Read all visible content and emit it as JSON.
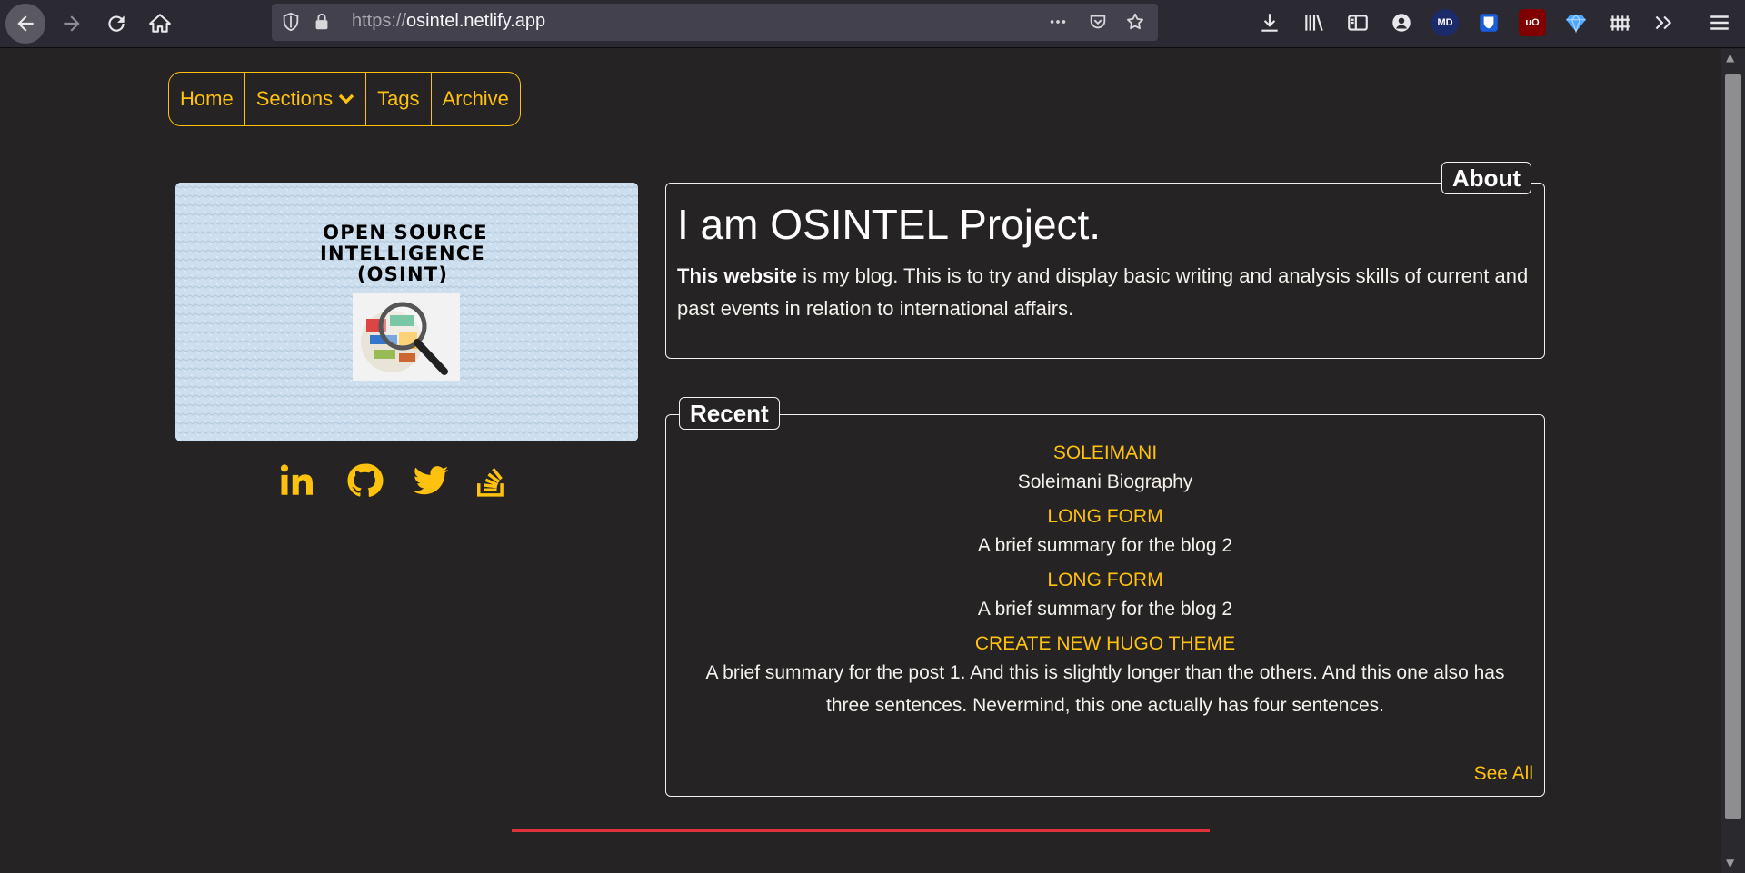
{
  "browser": {
    "url_protocol": "https://",
    "url_host": "osintel.netlify.app",
    "extension_badges": [
      "MD",
      "uO"
    ]
  },
  "nav": {
    "items": [
      {
        "label": "Home"
      },
      {
        "label": "Sections"
      },
      {
        "label": "Tags"
      },
      {
        "label": "Archive"
      }
    ]
  },
  "hero": {
    "line1": "OPEN SOURCE",
    "line2": "INTELLIGENCE",
    "line3": "(OSINT)"
  },
  "social": [
    "linkedin-icon",
    "github-icon",
    "twitter-icon",
    "stackoverflow-icon"
  ],
  "about": {
    "legend": "About",
    "heading": "I am OSINTEL Project.",
    "text_bold": "This website",
    "text_rest": " is my blog. This is to try and display basic writing and analysis skills of current and past events in relation to international affairs."
  },
  "recent": {
    "legend": "Recent",
    "posts": [
      {
        "title": "SOLEIMANI",
        "summary": "Soleimani Biography"
      },
      {
        "title": "LONG FORM",
        "summary": "A brief summary for the blog 2"
      },
      {
        "title": "LONG FORM",
        "summary": "A brief summary for the blog 2"
      },
      {
        "title": "CREATE NEW HUGO THEME",
        "summary": "A brief summary for the post 1. And this is slightly longer than the others. And this one also has three sentences. Nevermind, this one actually has four sentences."
      }
    ],
    "see_all": "See All"
  },
  "colors": {
    "background": "#252323",
    "accent": "#fec10e",
    "text": "#f4f1ec",
    "divider": "#e0313d"
  }
}
